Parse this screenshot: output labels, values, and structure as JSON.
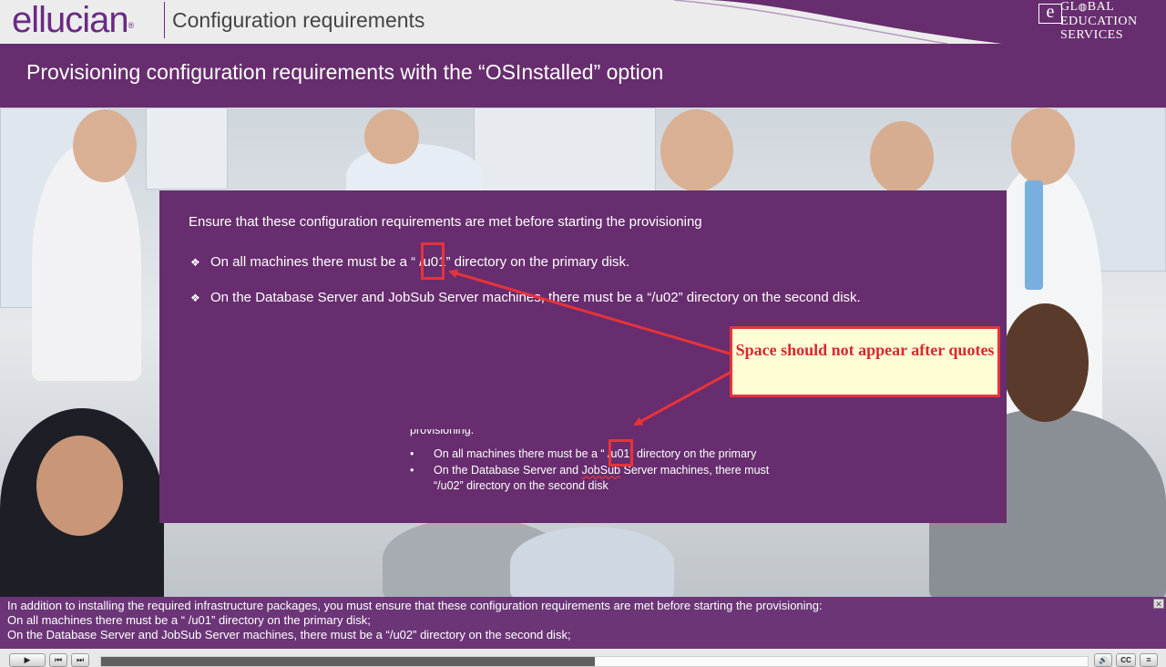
{
  "header": {
    "logo": "ellucian",
    "logo_mark": "®",
    "title": "Configuration requirements",
    "badge": {
      "e_mark": "e",
      "line1": "GL",
      "line1_end": "BAL",
      "line2": "EDUCATION",
      "line3": "SERVICES"
    }
  },
  "slide": {
    "heading": "Provisioning configuration requirements with the “OSInstalled” option",
    "intro": "Ensure that these configuration requirements are met before starting the provisioning",
    "bullets": [
      "On all machines there must be a “ /u01” directory on the primary disk.",
      "On the Database Server and JobSub Server machines, there must be a “/u02” directory on the second disk."
    ],
    "bullet_symbol": "❖",
    "inset": {
      "line0": "provisioning.",
      "bullet_symbol": "•",
      "line1": "On all machines there must be a “ /u01” directory on the primary",
      "line2_pre": "On the Database Server and ",
      "line2_wavy": "JobSub",
      "line2_post": " Server machines, there must",
      "line3": "“/u02” directory on the second disk"
    },
    "callout": "Space should not appear after quotes"
  },
  "caption": {
    "lines": [
      "In addition to installing the required infrastructure packages, you must ensure that these configuration requirements are met before starting the provisioning:",
      "On all machines there must be a “ /u01” directory on the primary disk;",
      "On the Database Server and JobSub Server machines, there must be a “/u02” directory on the second disk;"
    ],
    "close_glyph": "✕"
  },
  "player": {
    "play_glyph": "▶",
    "prev_glyph": "⏮",
    "next_glyph": "⏭",
    "volume_glyph": "🔊",
    "cc_label": "CC",
    "menu_glyph": "≡",
    "progress": 0.5
  },
  "colors": {
    "purple": "#672d6e",
    "annotation_red": "#e8333a",
    "callout_bg": "#fffdd6"
  }
}
